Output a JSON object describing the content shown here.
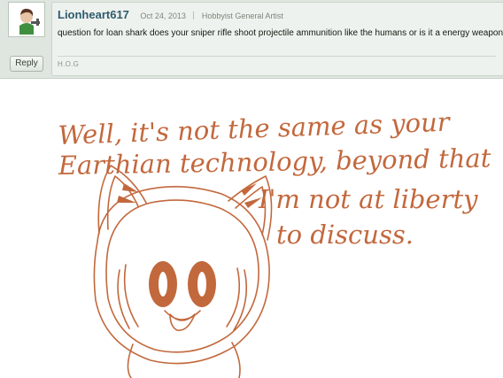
{
  "comment": {
    "username": "Lionheart617",
    "date": "Oct 24, 2013",
    "user_role": "Hobbyist General Artist",
    "text": "question for loan shark does your sniper rifle shoot projectile ammunition like the humans or is it a energy weapon",
    "signature": "H.O.G",
    "reply_label": "Reply"
  },
  "artwork": {
    "speech_lines": [
      "Well, it's not the same as your",
      "Earthian technology, beyond that",
      "I'm not at liberty",
      "to discuss."
    ],
    "ink_color": "#c2683d"
  },
  "icons": {
    "avatar": "user-avatar-icon"
  }
}
